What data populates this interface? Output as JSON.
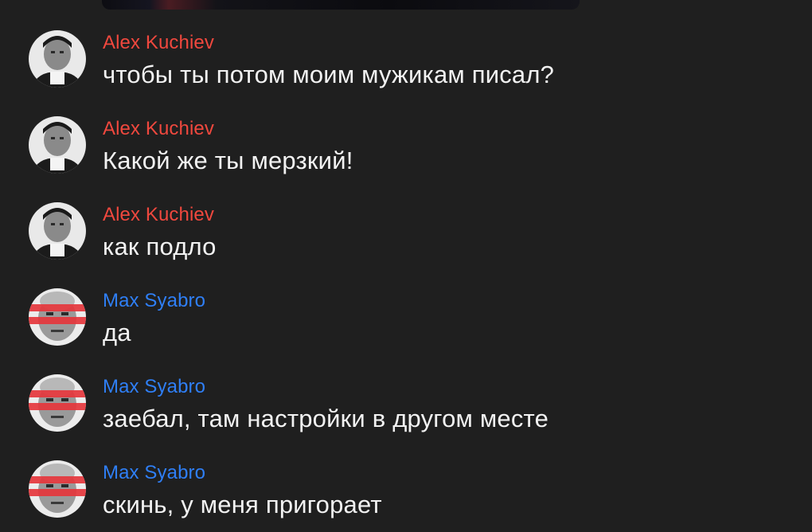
{
  "colors": {
    "background": "#1f1f1f",
    "author_alex": "#f0483e",
    "author_max": "#2f7ff6",
    "message_text": "#f2f2f2"
  },
  "messages": [
    {
      "author": "Alex Kuchiev",
      "avatar": "avatar-alex-icon",
      "text": "чтобы ты потом моим мужикам писал?"
    },
    {
      "author": "Alex Kuchiev",
      "avatar": "avatar-alex-icon",
      "text": "Какой же ты мерзкий!"
    },
    {
      "author": "Alex Kuchiev",
      "avatar": "avatar-alex-icon",
      "text": "как подло"
    },
    {
      "author": "Max Syabro",
      "avatar": "avatar-max-icon",
      "text": "да"
    },
    {
      "author": "Max Syabro",
      "avatar": "avatar-max-icon",
      "text": "заебал, там настройки в другом месте"
    },
    {
      "author": "Max Syabro",
      "avatar": "avatar-max-icon",
      "text": "скинь, у меня пригорает"
    }
  ]
}
